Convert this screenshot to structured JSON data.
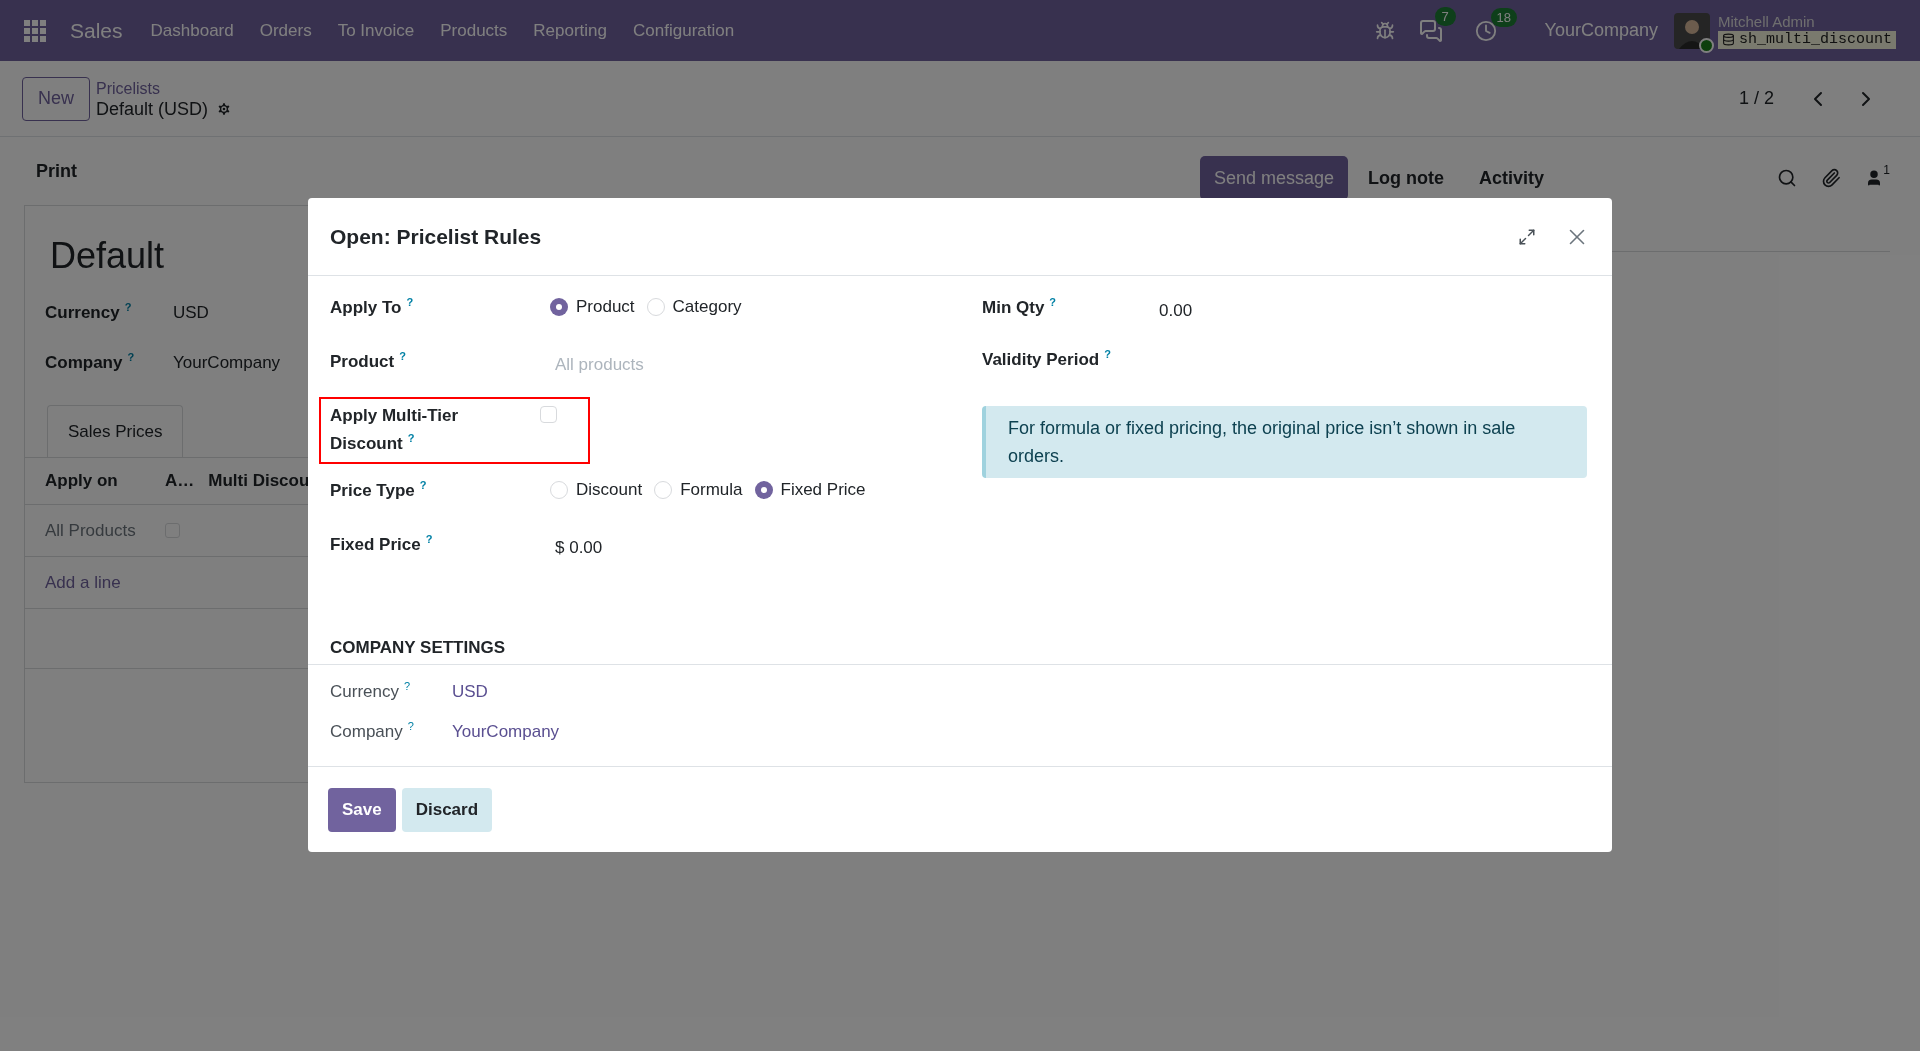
{
  "navbar": {
    "app": "Sales",
    "menu": [
      "Dashboard",
      "Orders",
      "To Invoice",
      "Products",
      "Reporting",
      "Configuration"
    ],
    "messages_badge": "7",
    "activities_badge": "18",
    "company": "YourCompany",
    "user": "Mitchell Admin",
    "database": "sh_multi_discount"
  },
  "control_panel": {
    "new_button": "New",
    "breadcrumb": "Pricelists",
    "record": "Default (USD)",
    "pager": "1 / 2"
  },
  "form": {
    "status_buttons": [
      "Print"
    ],
    "title": "Default",
    "fields": [
      {
        "label": "Currency",
        "help": "?",
        "value": "USD"
      },
      {
        "label": "Company",
        "help": "?",
        "value": "YourCompany"
      }
    ],
    "tabs": [
      {
        "label": "Sales Prices",
        "selected": true
      }
    ],
    "table": {
      "columns": [
        "Apply on",
        "A…",
        "Multi Discou"
      ],
      "rows": [
        {
          "cells": [
            "All Products"
          ],
          "checked": false
        }
      ],
      "add_line": "Add a line"
    }
  },
  "chatter": {
    "buttons": [
      {
        "label": "Send message",
        "selected": true
      },
      {
        "label": "Log note",
        "selected": false
      },
      {
        "label": "Activity",
        "selected": false
      }
    ],
    "followers": "1"
  },
  "dialog": {
    "title": "Open: Pricelist Rules",
    "left_fields": [
      {
        "kind": "radio",
        "label": "Apply To",
        "help": "?",
        "options": [
          {
            "label": "Product",
            "selected": true
          },
          {
            "label": "Category",
            "selected": false
          }
        ]
      },
      {
        "kind": "placeholder",
        "label": "Product",
        "help": "?",
        "placeholder": "All products"
      },
      {
        "kind": "checkbox",
        "label": "Apply Multi-Tier Discount",
        "help": "?",
        "checked": false,
        "highlighted": true
      },
      {
        "kind": "radio",
        "label": "Price Type",
        "help": "?",
        "options": [
          {
            "label": "Discount",
            "selected": false
          },
          {
            "label": "Formula",
            "selected": false
          },
          {
            "label": "Fixed Price",
            "selected": true
          }
        ]
      },
      {
        "kind": "text",
        "label": "Fixed Price",
        "help": "?",
        "value": "$ 0.00"
      }
    ],
    "right_fields": [
      {
        "kind": "text",
        "label": "Min Qty",
        "help": "?",
        "value": "0.00"
      },
      {
        "kind": "empty",
        "label": "Validity Period",
        "help": "?"
      }
    ],
    "alert": "For formula or fixed pricing, the original price isn’t shown in sale orders.",
    "section": "COMPANY SETTINGS",
    "company_fields": [
      {
        "label": "Currency",
        "help": "?",
        "value": "USD"
      },
      {
        "label": "Company",
        "help": "?",
        "value": "YourCompany"
      }
    ],
    "buttons": [
      {
        "label": "Save",
        "kind": "primary"
      },
      {
        "label": "Discard",
        "kind": "secondary"
      }
    ]
  }
}
